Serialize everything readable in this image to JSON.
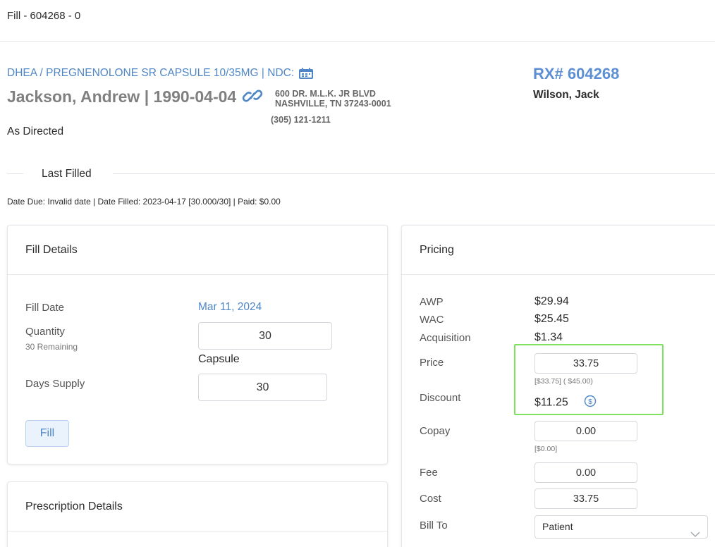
{
  "header": {
    "fill_title": "Fill - 604268 - 0"
  },
  "rx": {
    "drug_line": "DHEA / PREGNENOLONE SR CAPSULE 10/35MG | NDC:",
    "ndc_icon": "barcode-calendar-icon",
    "patient_line": "Jackson, Andrew | 1990-04-04",
    "link_icon": "link-icon",
    "address_line1": "600 DR. M.L.K. JR BLVD",
    "address_line2": "NASHVILLE, TN 37243-0001",
    "phone": "(305) 121-1211",
    "directions": "As Directed",
    "rx_number": "RX# 604268",
    "prescriber": "Wilson, Jack"
  },
  "last_filled": {
    "label": "Last Filled",
    "info": "Date Due: Invalid date | Date Filled: 2023-04-17 [30.000/30] | Paid: $0.00"
  },
  "fill_details": {
    "title": "Fill Details",
    "fill_date_label": "Fill Date",
    "fill_date_value": "Mar 11, 2024",
    "quantity_label": "Quantity",
    "quantity_remaining": "30 Remaining",
    "quantity_value": "30",
    "quantity_unit": "Capsule",
    "days_supply_label": "Days Supply",
    "days_supply_value": "30",
    "fill_button": "Fill"
  },
  "prescription_details": {
    "title": "Prescription Details"
  },
  "pricing": {
    "title": "Pricing",
    "awp_label": "AWP",
    "awp_value": "$29.94",
    "wac_label": "WAC",
    "wac_value": "$25.45",
    "acquisition_label": "Acquisition",
    "acquisition_value": "$1.34",
    "price_label": "Price",
    "price_value": "33.75",
    "price_hint": "[$33.75] ( $45.00)",
    "discount_label": "Discount",
    "discount_value": "$11.25",
    "discount_icon": "dollar-circle-icon",
    "copay_label": "Copay",
    "copay_value": "0.00",
    "copay_hint": "[$0.00]",
    "fee_label": "Fee",
    "fee_value": "0.00",
    "cost_label": "Cost",
    "cost_value": "33.75",
    "bill_to_label": "Bill To",
    "bill_to_value": "Patient"
  },
  "colors": {
    "link_blue": "#4f86c6",
    "rx_blue": "#5c8fd4",
    "highlight_green": "#7ee25f"
  }
}
